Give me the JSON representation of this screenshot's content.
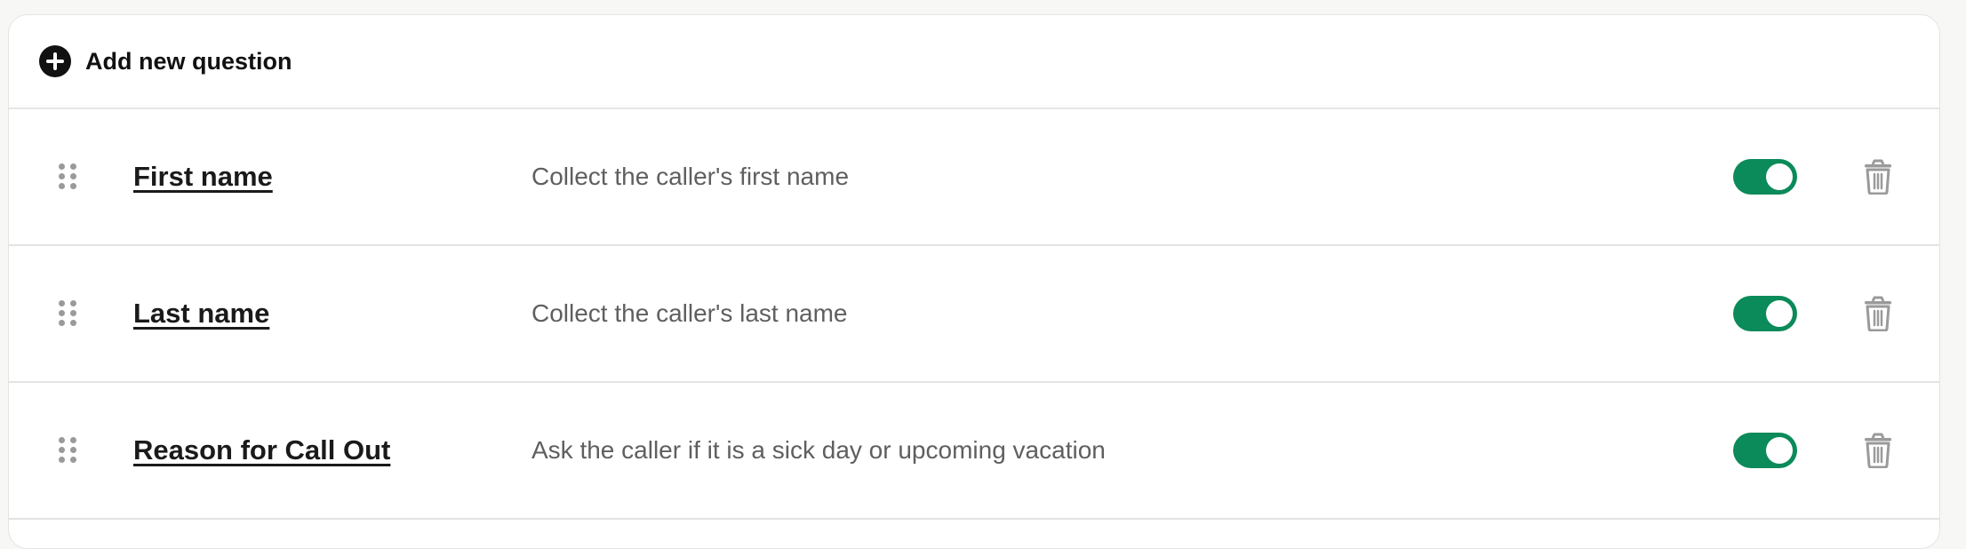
{
  "add_question": {
    "label": "Add new question"
  },
  "questions": [
    {
      "title": "First name",
      "description": "Collect the caller's first name",
      "enabled": true
    },
    {
      "title": "Last name",
      "description": "Collect the caller's last name",
      "enabled": true
    },
    {
      "title": "Reason for Call Out",
      "description": "Ask the caller if it is a sick day or upcoming vacation",
      "enabled": true
    }
  ],
  "icons": {
    "add": "plus-circle-icon",
    "drag": "drag-handle-icon",
    "delete": "trash-icon"
  },
  "colors": {
    "toggle_on": "#0b8a5a",
    "icon_gray": "#9a9a9a",
    "text_dark": "#1a1a1a",
    "text_muted": "#5f5f5f"
  }
}
